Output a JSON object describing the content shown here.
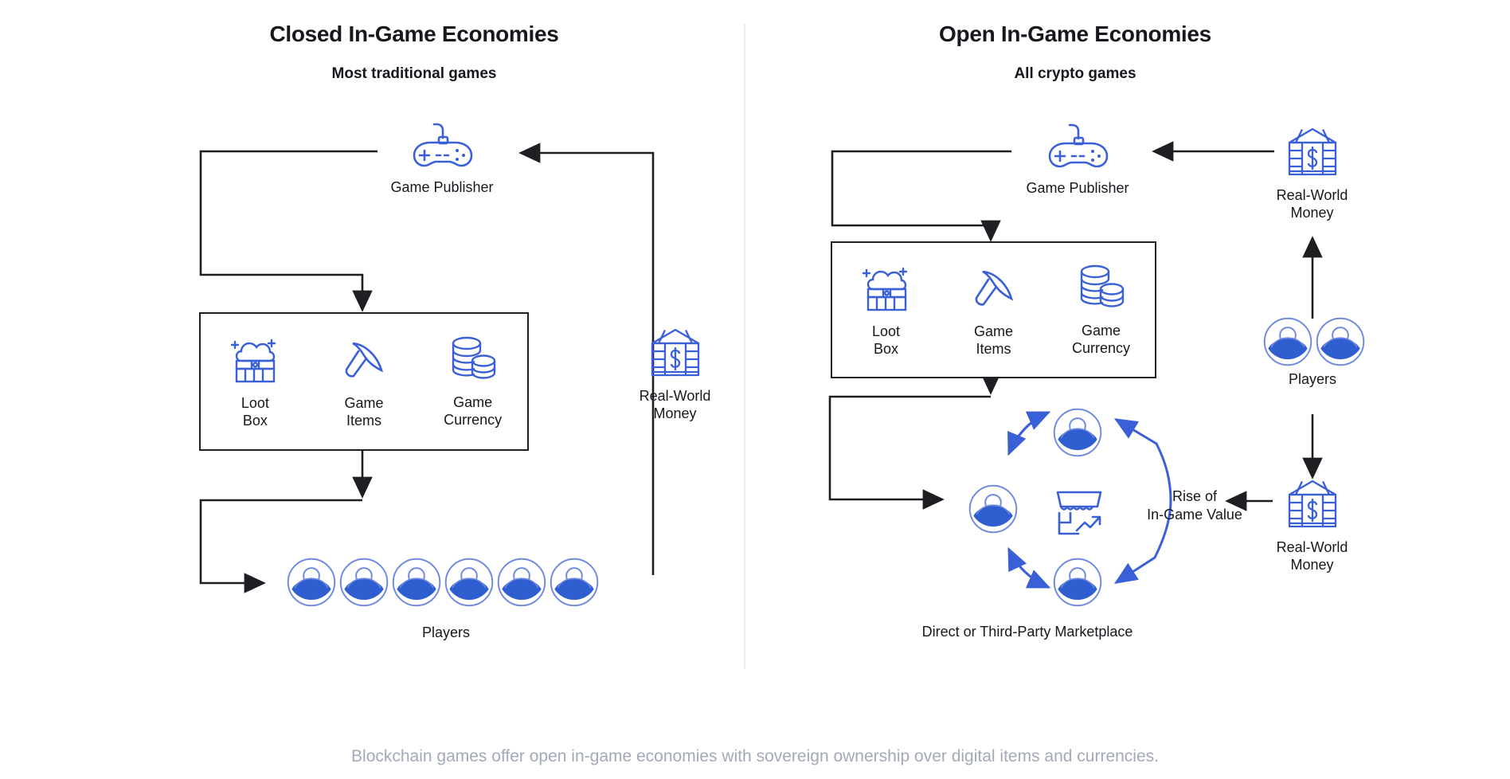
{
  "meta": {
    "accent_blue": "#3a60d8",
    "ink": "#16181d",
    "caption_grey": "#a3a9b8",
    "divider_color": "#e8edf7"
  },
  "caption": "Blockchain games offer open in-game economies with sovereign ownership over digital items and currencies.",
  "panels": {
    "left": {
      "title": "Closed In-Game Economies",
      "subtitle": "Most traditional games",
      "publisher": {
        "label": "Game Publisher",
        "icon": "gamepad-icon"
      },
      "inventory": [
        {
          "label": "Loot\nBox",
          "icon": "loot-box-icon"
        },
        {
          "label": "Game\nItems",
          "icon": "pickaxe-icon"
        },
        {
          "label": "Game\nCurrency",
          "icon": "coins-icon"
        }
      ],
      "money": {
        "label": "Real-World\nMoney",
        "icon": "bank-dollar-icon"
      },
      "players": {
        "label": "Players",
        "count": 6,
        "icon": "player-avatar-icon"
      }
    },
    "right": {
      "title": "Open In-Game Economies",
      "subtitle": "All crypto games",
      "publisher": {
        "label": "Game Publisher",
        "icon": "gamepad-icon"
      },
      "inventory": [
        {
          "label": "Loot\nBox",
          "icon": "loot-box-icon"
        },
        {
          "label": "Game\nItems",
          "icon": "pickaxe-icon"
        },
        {
          "label": "Game\nCurrency",
          "icon": "coins-icon"
        }
      ],
      "money_top": {
        "label": "Real-World\nMoney",
        "icon": "bank-dollar-icon"
      },
      "money_bottom": {
        "label": "Real-World\nMoney",
        "icon": "bank-dollar-icon"
      },
      "players": {
        "label": "Players",
        "count": 2,
        "icon": "player-avatar-icon"
      },
      "marketplace": {
        "label": "Direct or Third-Party Marketplace",
        "center_icon": "storefront-chart-icon",
        "value_note": "Rise of\nIn-Game Value",
        "participants": 3
      }
    }
  },
  "chart_data": {
    "type": "diagram",
    "title": "Closed vs Open In-Game Economies",
    "nodes": [
      "Game Publisher",
      "Loot Box",
      "Game Items",
      "Game Currency",
      "Real-World Money",
      "Players",
      "Direct or Third-Party Marketplace",
      "Rise of In-Game Value"
    ],
    "left_flow": [
      "Game Publisher -> Loot Box / Game Items / Game Currency",
      "Loot Box / Game Items / Game Currency -> Players",
      "Players -> Real-World Money",
      "Real-World Money -> Game Publisher"
    ],
    "right_flow": [
      "Game Publisher -> Loot Box / Game Items / Game Currency",
      "Loot Box / Game Items / Game Currency -> Direct or Third-Party Marketplace",
      "Real-World Money -> Rise of In-Game Value",
      "Players -> Real-World Money (up)",
      "Players -> Real-World Money (down)",
      "Real-World Money -> Game Publisher"
    ]
  }
}
